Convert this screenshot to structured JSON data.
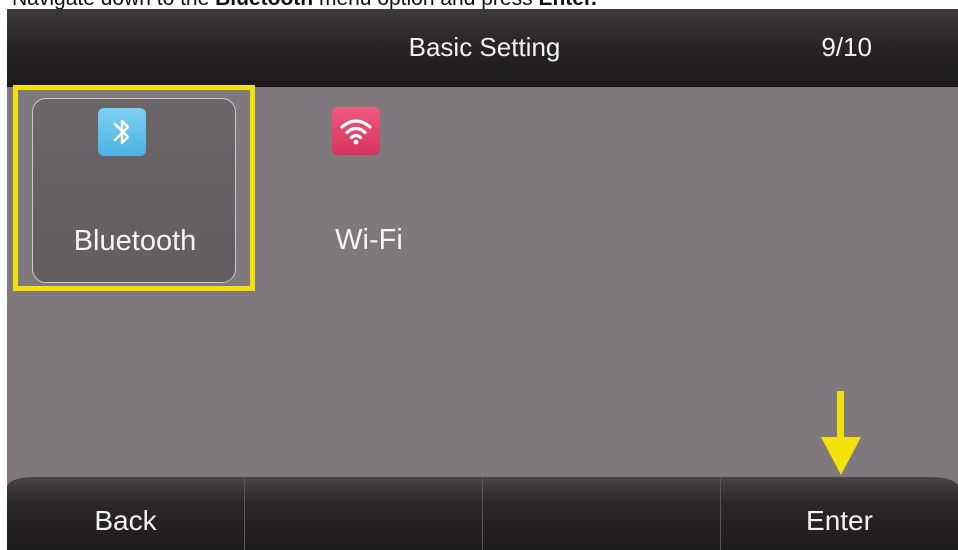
{
  "instruction": {
    "prefix": "Navigate down to the ",
    "emphasis": "Bluetooth",
    "middle": " menu option and press ",
    "action": "Enter."
  },
  "header": {
    "title": "Basic Setting",
    "page_indicator": "9/10"
  },
  "menu": {
    "items": [
      {
        "label": "Bluetooth",
        "icon": "bluetooth-icon",
        "selected": true,
        "color": "#5dbde9"
      },
      {
        "label": "Wi-Fi",
        "icon": "wifi-icon",
        "selected": false,
        "color": "#e1406a"
      }
    ]
  },
  "softkeys": [
    {
      "label": "Back"
    },
    {
      "label": ""
    },
    {
      "label": ""
    },
    {
      "label": "Enter"
    }
  ],
  "colors": {
    "highlight": "#f2e20a",
    "screen_bg": "#7f797e",
    "bar_bg": "#2a2628"
  }
}
